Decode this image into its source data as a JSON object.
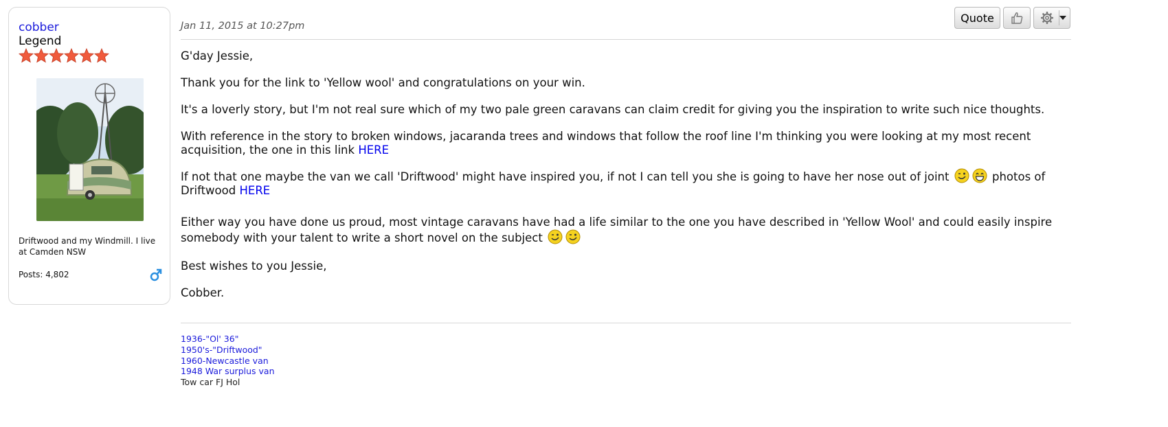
{
  "author": {
    "name": "cobber",
    "rank": "Legend",
    "stars": 6,
    "signature_text": "Driftwood and my Windmill. I live at Camden NSW",
    "posts_label": "Posts: 4,802",
    "gender_icon": "male-symbol-icon",
    "avatar_alt": "Driftwood and my Windmill"
  },
  "post": {
    "date": "Jan 11, 2015 at 10:27pm",
    "paragraphs": {
      "p1": "G'day Jessie,",
      "p2": "Thank you for the link to 'Yellow wool' and congratulations on your win.",
      "p3": "It's a loverly story, but I'm not real sure which of my two pale green caravans can claim credit for giving you the inspiration to write such nice thoughts.",
      "p4": "With reference in the story to broken windows, jacaranda trees and windows that follow the roof line I'm thinking you were looking at my most recent acquisition, the one in this link",
      "p4_link": "HERE",
      "p5a": "If not that one maybe the van we call 'Driftwood' might have inspired you, if not I can tell you she is going to have her nose out of joint",
      "p5b": "photos of Driftwood",
      "p5_link": "HERE",
      "p6": "Either way you have done us proud, most vintage caravans have had a life similar to the one you have described in 'Yellow Wool' and could easily inspire somebody with your talent to write a short novel on the subject",
      "p7": "Best wishes to you Jessie,",
      "p8": "Cobber."
    }
  },
  "toolbar": {
    "quote_label": "Quote",
    "like_icon": "thumbs-up-icon",
    "gear_icon": "gear-icon"
  },
  "signature": {
    "links": [
      "1936-\"Ol' 36\"",
      "1950's-\"Driftwood\"",
      "1960-Newcastle van",
      "1948 War surplus van"
    ],
    "plain": "Tow car FJ Hol"
  },
  "colors": {
    "link": "#0000ee",
    "username": "#1a1adb",
    "star": "#f05a3c"
  }
}
